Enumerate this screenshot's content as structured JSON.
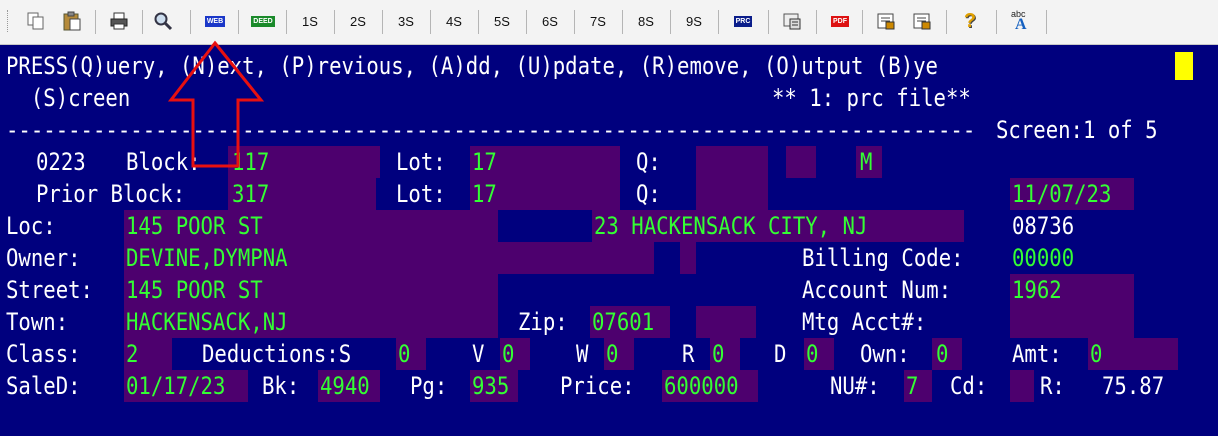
{
  "toolbar": {
    "buttons": [
      {
        "name": "copy-icon"
      },
      {
        "name": "paste-icon"
      },
      {
        "name": "print-icon"
      },
      {
        "name": "search-icon"
      },
      {
        "name": "web-icon",
        "label": "WEB"
      },
      {
        "name": "deed-icon",
        "label": "DEED"
      },
      {
        "name": "1s-button",
        "label": "1S"
      },
      {
        "name": "2s-button",
        "label": "2S"
      },
      {
        "name": "3s-button",
        "label": "3S"
      },
      {
        "name": "4s-button",
        "label": "4S"
      },
      {
        "name": "5s-button",
        "label": "5S"
      },
      {
        "name": "6s-button",
        "label": "6S"
      },
      {
        "name": "7s-button",
        "label": "7S"
      },
      {
        "name": "8s-button",
        "label": "8S"
      },
      {
        "name": "9s-button",
        "label": "9S"
      },
      {
        "name": "prc-icon",
        "label": "PRC"
      },
      {
        "name": "settings-icon"
      },
      {
        "name": "pdf-icon",
        "label": "PDF"
      },
      {
        "name": "properties-icon"
      },
      {
        "name": "properties2-icon"
      },
      {
        "name": "help-icon",
        "label": "?"
      },
      {
        "name": "spell-icon",
        "label": "abc"
      }
    ]
  },
  "screen": {
    "prompt_line1": "PRESS(Q)uery, (N)ext, (P)revious, (A)dd, (U)pdate, (R)emove, (O)utput (B)ye",
    "prompt_line2": "  (S)creen",
    "file_label": "** 1: prc file**",
    "divider": "------------------------------------------------------------------------------",
    "screen_label": "Screen:1 of 5",
    "district": "0223",
    "block_label": "Block:",
    "block": "117",
    "lot_label": "Lot:",
    "lot": "17",
    "q_label": "Q:",
    "status_code": "M",
    "prior_label": "Prior Block:",
    "prior_block": "317",
    "prior_lot_label": "Lot:",
    "prior_lot": "17",
    "prior_q_label": "Q:",
    "prior_date": "11/07/23",
    "loc_label": "Loc:",
    "loc": "145 POOR ST",
    "city_code": "23 HACKENSACK CITY, NJ",
    "zip_code": "08736",
    "owner_label": "Owner:",
    "owner": "DEVINE,DYMPNA",
    "billing_label": "Billing Code:",
    "billing_code": "00000",
    "street_label": "Street:",
    "street": "145 POOR ST",
    "account_label": "Account Num:",
    "account_num": "1962",
    "town_label": "Town:",
    "town": "HACKENSACK,NJ",
    "zip_label": "Zip:",
    "zip": "07601",
    "mtg_label": "Mtg Acct#:",
    "class_label": "Class:",
    "class": "2",
    "deductions_label": "Deductions:S",
    "ded_s": "0",
    "v_label": "V",
    "ded_v": "0",
    "w_label": "W",
    "ded_w": "0",
    "r_label": "R",
    "ded_r": "0",
    "d_label": "D",
    "ded_d": "0",
    "own_label": "Own:",
    "own": "0",
    "amt_label": "Amt:",
    "amt": "0",
    "saled_label": "SaleD:",
    "sale_date": "01/17/23",
    "bk_label": "Bk:",
    "bk": "4940",
    "pg_label": "Pg:",
    "pg": "935",
    "price_label": "Price:",
    "price": "600000",
    "nu_label": "NU#:",
    "nu": "7",
    "cd_label": "Cd:",
    "r2_label": "R:",
    "r2": "75.87"
  },
  "colors": {
    "screen_bg": "#00007e",
    "field_text": "#33ff33",
    "label_text": "#ffffff",
    "highlight": "#4d006e",
    "cursor": "#ffff00",
    "arrow": "#e81010"
  }
}
